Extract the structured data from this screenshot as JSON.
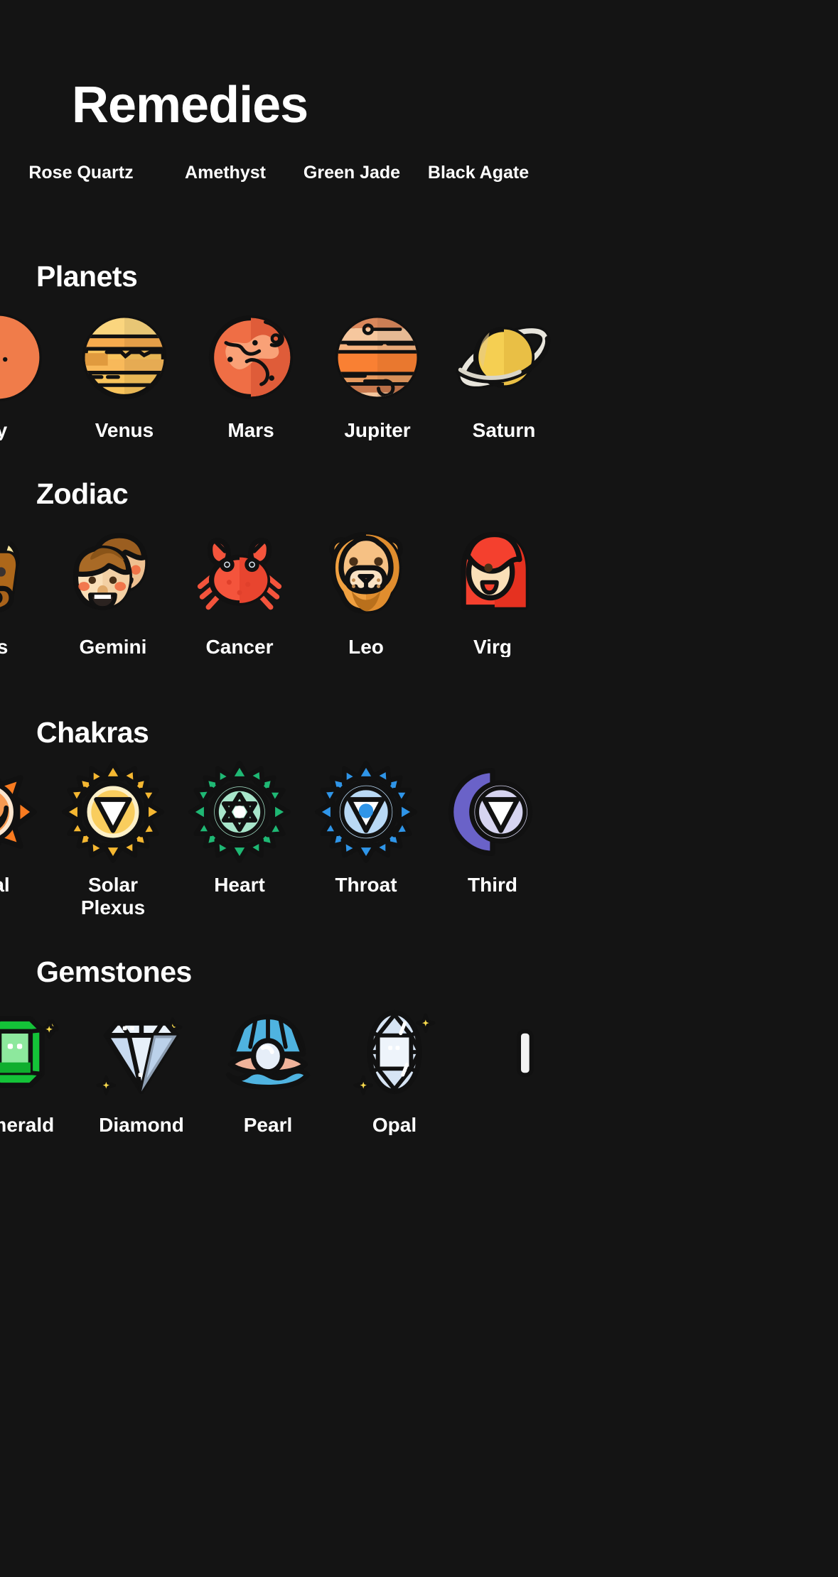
{
  "header": {
    "title": "Remedies"
  },
  "remedies": {
    "items": [
      {
        "label": "Rose\nQuartz",
        "icon": "rose-quartz-icon"
      },
      {
        "label": "Amethyst",
        "icon": "amethyst-icon"
      },
      {
        "label": "Green\nJade",
        "icon": "green-jade-icon"
      },
      {
        "label": "Black\nAgate",
        "icon": "black-agate-icon"
      }
    ]
  },
  "sections": [
    {
      "id": "planets",
      "title": "Planets",
      "items": [
        {
          "label": "ry",
          "full": "Mercury",
          "icon": "mercury-planet-icon",
          "clipped": "left"
        },
        {
          "label": "Venus",
          "full": "Venus",
          "icon": "venus-planet-icon"
        },
        {
          "label": "Mars",
          "full": "Mars",
          "icon": "mars-planet-icon"
        },
        {
          "label": "Jupiter",
          "full": "Jupiter",
          "icon": "jupiter-planet-icon"
        },
        {
          "label": "Saturn",
          "full": "Saturn",
          "icon": "saturn-planet-icon",
          "clipped": "right"
        }
      ]
    },
    {
      "id": "zodiac",
      "title": "Zodiac",
      "items": [
        {
          "label": "urus",
          "full": "Taurus",
          "icon": "taurus-bull-icon",
          "clipped": "left"
        },
        {
          "label": "Gemini",
          "full": "Gemini",
          "icon": "gemini-twins-icon"
        },
        {
          "label": "Cancer",
          "full": "Cancer",
          "icon": "cancer-crab-icon"
        },
        {
          "label": "Leo",
          "full": "Leo",
          "icon": "leo-lion-icon"
        },
        {
          "label": "Virg",
          "full": "Virgo",
          "icon": "virgo-maiden-icon",
          "clipped": "right"
        }
      ]
    },
    {
      "id": "chakras",
      "title": "Chakras",
      "items": [
        {
          "label": "acral",
          "full": "Sacral",
          "icon": "sacral-chakra-icon",
          "clipped": "left"
        },
        {
          "label": "Solar\nPlexus",
          "full": "Solar Plexus",
          "icon": "solar-plexus-chakra-icon"
        },
        {
          "label": "Heart",
          "full": "Heart",
          "icon": "heart-chakra-icon"
        },
        {
          "label": "Throat",
          "full": "Throat",
          "icon": "throat-chakra-icon"
        },
        {
          "label": "Third",
          "full": "Third Eye",
          "icon": "third-eye-chakra-icon",
          "clipped": "right"
        }
      ]
    },
    {
      "id": "gemstones",
      "title": "Gemstones",
      "items": [
        {
          "label": "Emerald",
          "full": "Emerald",
          "icon": "emerald-gem-icon"
        },
        {
          "label": "Diamond",
          "full": "Diamond",
          "icon": "diamond-gem-icon"
        },
        {
          "label": "Pearl",
          "full": "Pearl",
          "icon": "pearl-shell-icon"
        },
        {
          "label": "Opal",
          "full": "Opal",
          "icon": "opal-gem-icon"
        },
        {
          "label": "",
          "full": "",
          "icon": "next-gem-icon",
          "clipped": "right"
        }
      ]
    }
  ],
  "colors": {
    "background": "#141414",
    "text": "#ffffff",
    "outline": "#111111",
    "mercury": "#f98e5a",
    "venus": "#f9c45c",
    "mars": "#ef6e45",
    "jupiter": "#f98033",
    "saturn": "#f5cf52",
    "taurus": "#c57a20",
    "gemini": "#f7cfa4",
    "cancer": "#f4543c",
    "leo": "#f0a040",
    "virgo": "#f4402e",
    "sacral": "#f97b20",
    "solar_plexus": "#f5b731",
    "heart": "#1fb874",
    "throat": "#2f95e8",
    "third_eye": "#6a62c8",
    "emerald": "#14c338",
    "diamond": "#c8daf0",
    "pearl": "#4fb3e0",
    "opal": "#d6e4f4",
    "sparkle": "#f7d94c"
  }
}
